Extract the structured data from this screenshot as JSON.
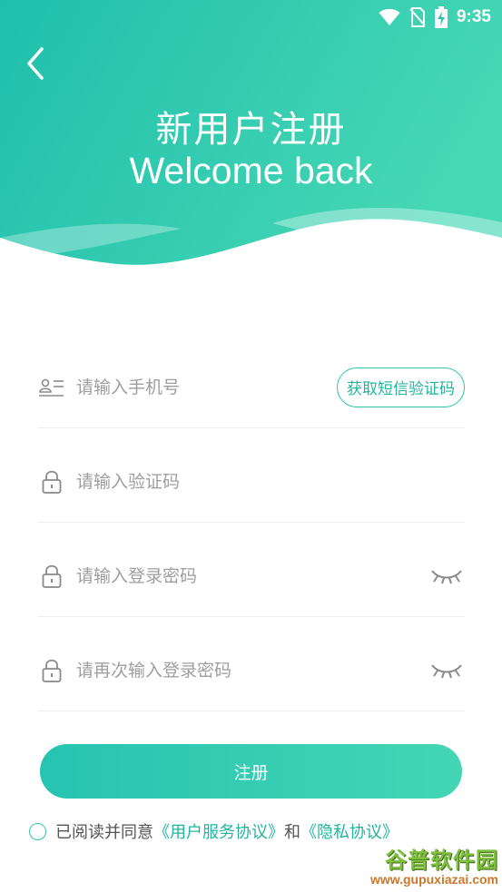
{
  "status_bar": {
    "time": "9:35",
    "icons": [
      "wifi-icon",
      "no-sim-icon",
      "battery-charging-icon"
    ]
  },
  "header": {
    "title_cn": "新用户注册",
    "title_en": "Welcome back",
    "gradient_start": "#1fbfac",
    "gradient_end": "#46d7b4"
  },
  "form": {
    "phone": {
      "placeholder": "请输入手机号",
      "value": "",
      "icon": "contact-card-icon"
    },
    "sms_button_label": "获取短信验证码",
    "code": {
      "placeholder": "请输入验证码",
      "value": "",
      "icon": "lock-icon"
    },
    "password": {
      "placeholder": "请输入登录密码",
      "value": "",
      "icon": "lock-icon",
      "toggle_icon": "eye-closed-icon"
    },
    "password_confirm": {
      "placeholder": "请再次输入登录密码",
      "value": "",
      "icon": "lock-icon",
      "toggle_icon": "eye-closed-icon"
    },
    "submit_label": "注册"
  },
  "agreement": {
    "prefix": "已阅读并同意",
    "user_agreement": "《用户服务协议》",
    "and": "和",
    "privacy": "《隐私协议》"
  },
  "watermark": {
    "title": "谷普软件园",
    "url": "www.gupuxiazai.com"
  },
  "colors": {
    "accent": "#21b59e",
    "divider": "#ededed",
    "placeholder": "#9e9e9e"
  }
}
